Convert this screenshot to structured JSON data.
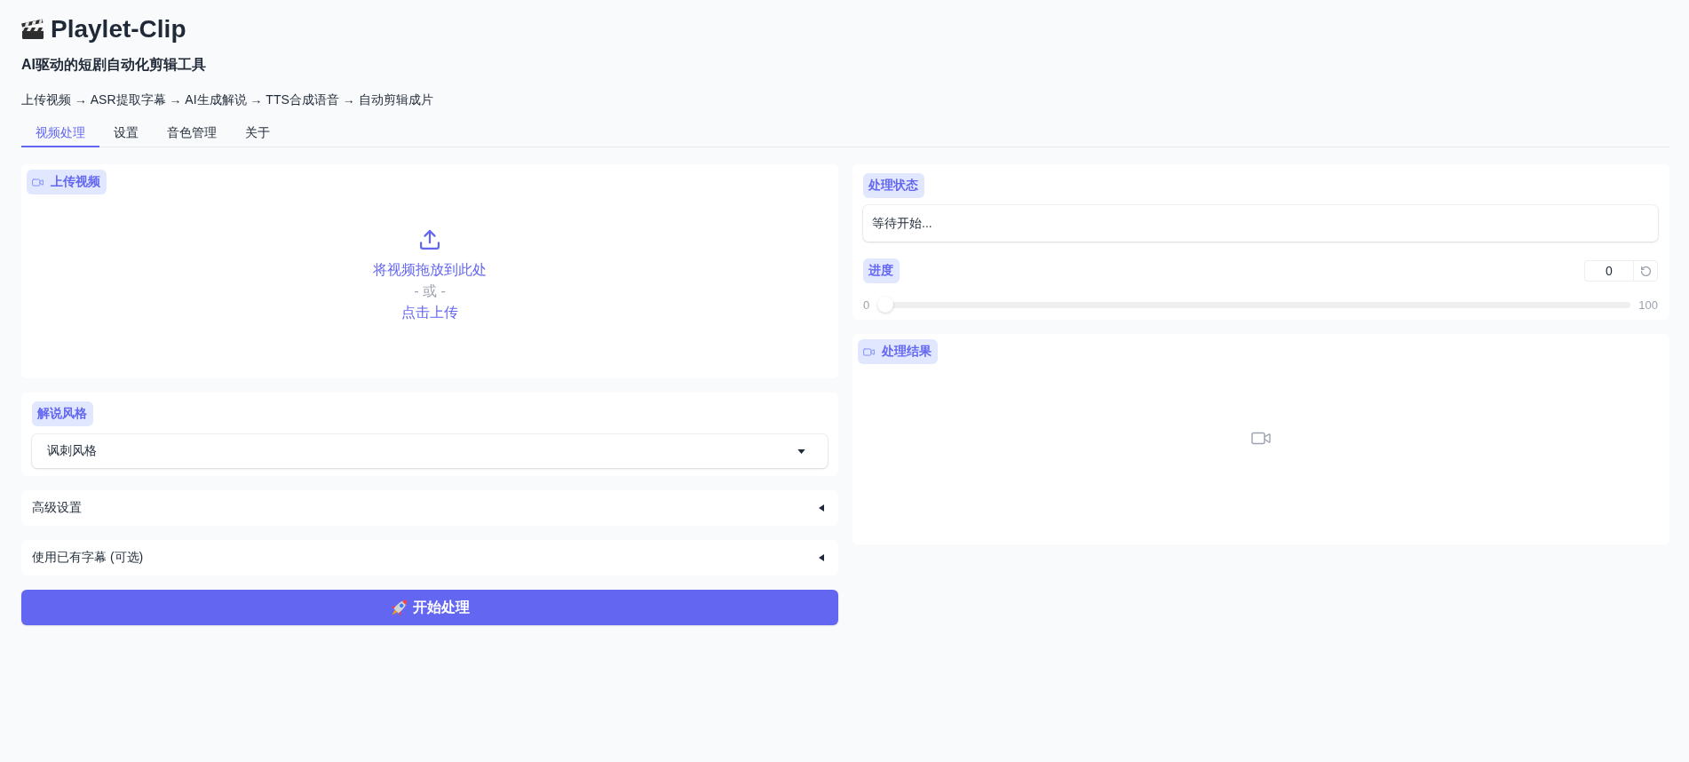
{
  "header": {
    "title": "Playlet-Clip",
    "subtitle": "AI驱动的短剧自动化剪辑工具",
    "pipeline": "上传视频 → ASR提取字幕 → AI生成解说 → TTS合成语音 → 自动剪辑成片"
  },
  "tabs": [
    {
      "label": "视频处理",
      "selected": true
    },
    {
      "label": "设置",
      "selected": false
    },
    {
      "label": "音色管理",
      "selected": false
    },
    {
      "label": "关于",
      "selected": false
    }
  ],
  "left": {
    "upload": {
      "label": "上传视频",
      "drop_text": "将视频拖放到此处",
      "or_text": "- 或 -",
      "click_text": "点击上传"
    },
    "style": {
      "label": "解说风格",
      "value": "讽刺风格"
    },
    "accordions": [
      {
        "label": "高级设置",
        "expanded": false
      },
      {
        "label": "使用已有字幕 (可选)",
        "expanded": false
      }
    ],
    "start_button": {
      "label": "开始处理"
    }
  },
  "right": {
    "status": {
      "label": "处理状态",
      "value": "等待开始..."
    },
    "progress": {
      "label": "进度",
      "value": "0",
      "level": 0,
      "min_label": "0",
      "max_label": "100"
    },
    "result": {
      "label": "处理结果"
    }
  }
}
